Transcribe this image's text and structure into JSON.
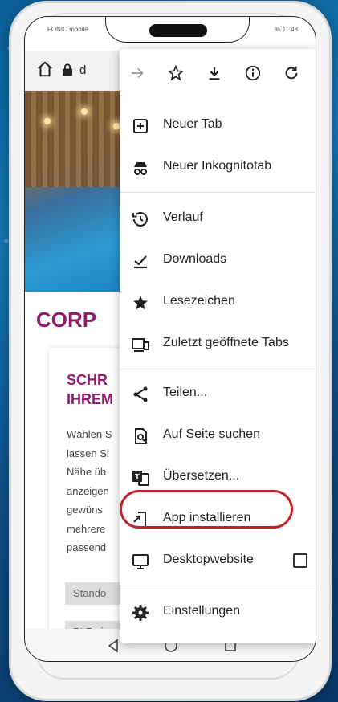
{
  "statusbar": {
    "carrier": "FONIC mobile",
    "right": "% 11:48"
  },
  "urlbar": {
    "url_text": "d"
  },
  "page": {
    "heading": "CORP",
    "card_title_line1": "SCHR",
    "card_title_line2": "IHREM",
    "card_body": [
      "Wählen S",
      "lassen Si",
      "Nähe üb",
      "anzeigen",
      "gewüns",
      "mehrere",
      "passend"
    ],
    "field1": "Stando",
    "field2": "PLZ ei"
  },
  "menu": {
    "toolbar": [
      "forward-icon",
      "star-icon",
      "download-icon",
      "info-icon",
      "refresh-icon"
    ],
    "items": [
      {
        "label": "Neuer Tab",
        "icon": "new-tab-icon"
      },
      {
        "label": "Neuer Inkognitotab",
        "icon": "incognito-icon"
      },
      {
        "label": "Verlauf",
        "icon": "history-icon"
      },
      {
        "label": "Downloads",
        "icon": "downloads-icon"
      },
      {
        "label": "Lesezeichen",
        "icon": "bookmarks-icon"
      },
      {
        "label": "Zuletzt geöffnete Tabs",
        "icon": "recent-tabs-icon"
      },
      {
        "label": "Teilen...",
        "icon": "share-icon"
      },
      {
        "label": "Auf Seite suchen",
        "icon": "find-in-page-icon"
      },
      {
        "label": "Übersetzen...",
        "icon": "translate-icon"
      },
      {
        "label": "App installieren",
        "icon": "install-app-icon"
      },
      {
        "label": "Desktopwebsite",
        "icon": "desktop-icon",
        "checked": false
      },
      {
        "label": "Einstellungen",
        "icon": "settings-icon"
      }
    ],
    "highlight_color": "#c0202a"
  },
  "navbar": {
    "buttons": [
      "back-icon",
      "home-icon",
      "recent-apps-icon"
    ]
  }
}
